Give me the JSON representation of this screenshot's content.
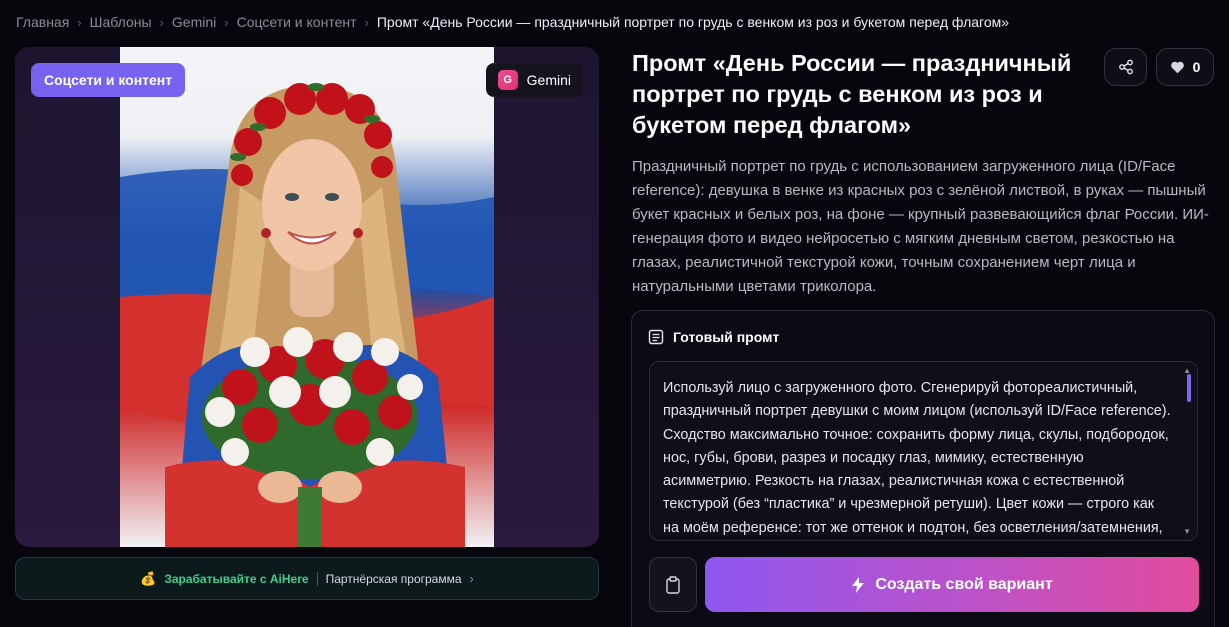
{
  "breadcrumb": {
    "items": [
      "Главная",
      "Шаблоны",
      "Gemini",
      "Соцсети и контент"
    ],
    "current": "Промт «День России — праздничный портрет по грудь с венком из роз и букетом перед флагом»"
  },
  "media": {
    "category_tag": "Соцсети и контент",
    "model_label": "Gemini",
    "model_icon_letter": "G"
  },
  "affiliate": {
    "earn_label": "Зарабатывайте с AiHere",
    "program_label": "Партнёрская программа",
    "icon": "money-bag-icon"
  },
  "header": {
    "title": "Промт «День России — праздничный портрет по грудь с венком из роз и букетом перед флагом»",
    "likes_count": "0"
  },
  "description": "Праздничный портрет по грудь с использованием загруженного лица (ID/Face reference): девушка в венке из красных роз с зелёной листвой, в руках — пышный букет красных и белых роз, на фоне — крупный развевающийся флаг России. ИИ-генерация фото и видео нейросетью с мягким дневным светом, резкостью на глазах, реалистичной текстурой кожи, точным сохранением черт лица и натуральными цветами триколора.",
  "prompt": {
    "header_label": "Готовый промт",
    "text": "Используй лицо с загруженного фото. Сгенерируй фотореалистичный, праздничный портрет девушки с моим лицом (используй ID/Face reference). Сходство максимально точное: сохранить форму лица, скулы, подбородок, нос, губы, брови, разрез и посадку глаз, мимику, естественную асимметрию. Резкость на глазах, реалистичная кожа с естественной текстурой (без “пластика” и чрезмерной ретуши). Цвет кожи — строго как на моём референсе: тот же оттенок и подтон, без осветления/затемнения, без загара, без изменения тональности",
    "create_label": "Создать свой вариант"
  },
  "colors": {
    "accent": "#7763f0",
    "earn_green": "#3fcf8e",
    "gradient_start": "#8e57f0",
    "gradient_end": "#e24c9c"
  }
}
